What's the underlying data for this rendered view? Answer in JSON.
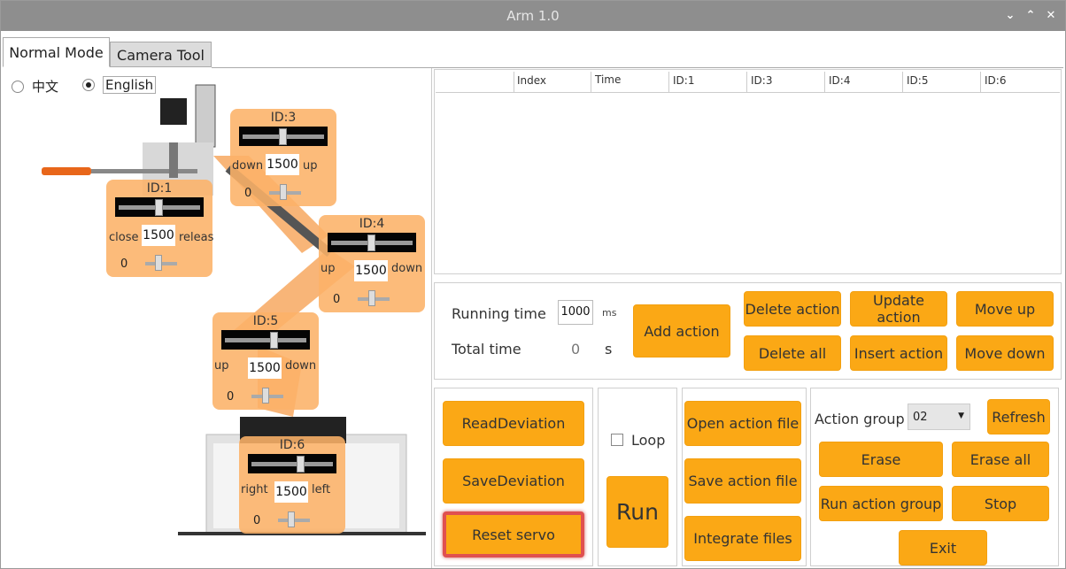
{
  "window": {
    "title": "Arm 1.0",
    "controls": [
      "⌄",
      "⌃",
      "✕"
    ]
  },
  "tabs": [
    {
      "label": "Normal Mode"
    },
    {
      "label": "Camera Tool"
    }
  ],
  "language": {
    "chinese": "中文",
    "english": "English",
    "selected": "English"
  },
  "servos": {
    "id1": {
      "id": "ID:1",
      "left": "close",
      "right": "releas",
      "value": "1500",
      "offset": "0"
    },
    "id3": {
      "id": "ID:3",
      "left": "down",
      "right": "up",
      "value": "1500",
      "offset": "0"
    },
    "id4": {
      "id": "ID:4",
      "left": "up",
      "right": "down",
      "value": "1500",
      "offset": "0"
    },
    "id5": {
      "id": "ID:5",
      "left": "up",
      "right": "down",
      "value": "1500",
      "offset": "0"
    },
    "id6": {
      "id": "ID:6",
      "left": "right",
      "right": "left",
      "value": "1500",
      "offset": "0"
    }
  },
  "table": {
    "columns": [
      "",
      "Index",
      "Time",
      "ID:1",
      "ID:3",
      "ID:4",
      "ID:5",
      "ID:6"
    ],
    "rows": []
  },
  "action": {
    "running_time_label": "Running time",
    "running_time_value": "1000",
    "running_time_unit": "ms",
    "total_time_label": "Total time",
    "total_time_value": "0",
    "total_time_unit": "s",
    "add": "Add action",
    "delete": "Delete action",
    "update": "Update action",
    "move_up": "Move up",
    "delete_all": "Delete all",
    "insert": "Insert action",
    "move_down": "Move down"
  },
  "deviation": {
    "read": "ReadDeviation",
    "save": "SaveDeviation",
    "reset": "Reset servo"
  },
  "run": {
    "loop": "Loop",
    "run": "Run"
  },
  "files": {
    "open": "Open action file",
    "save": "Save action file",
    "integrate": "Integrate files"
  },
  "group": {
    "label": "Action group",
    "selected": "02",
    "refresh": "Refresh",
    "erase": "Erase",
    "erase_all": "Erase all",
    "run_group": "Run action group",
    "stop": "Stop",
    "exit": "Exit"
  },
  "colors": {
    "accent": "#fba815",
    "servo_panel": "#fcb268",
    "titlebar": "#8e8e8e"
  }
}
